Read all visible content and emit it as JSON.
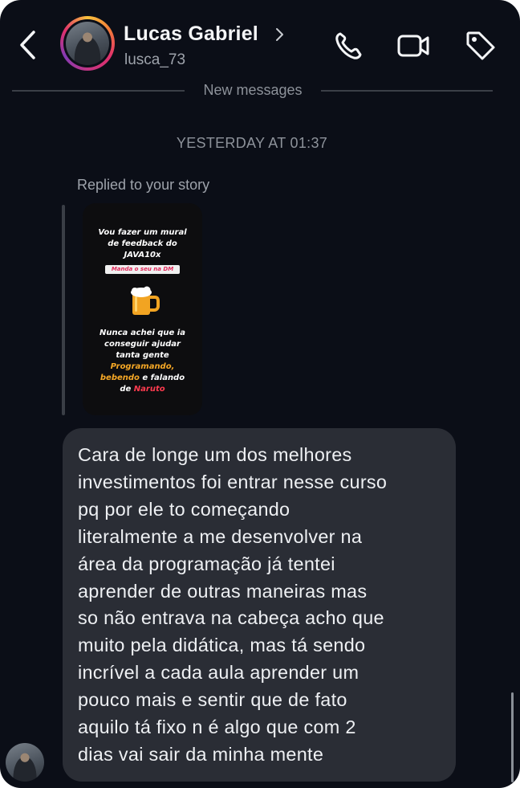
{
  "header": {
    "contact_name": "Lucas Gabriel",
    "contact_handle": "lusca_73",
    "icons": [
      "back-arrow-icon",
      "chevron-right-icon",
      "phone-icon",
      "video-camera-icon",
      "tag-icon"
    ]
  },
  "divider": {
    "label": "New messages"
  },
  "thread": {
    "timestamp": "YESTERDAY AT 01:37",
    "reply_label": "Replied to your story",
    "story": {
      "line1": "Vou fazer um mural",
      "line2": "de feedback do",
      "line3": "JAVA10x",
      "badge": "Manda o seu na DM",
      "emoji": "beer-mug-icon",
      "line4": "Nunca achei que ia",
      "line5": "conseguir ajudar",
      "line6": "tanta gente",
      "line7": "Programando,",
      "line8a": "bebendo",
      "line8b": " e falando",
      "line9a": "de ",
      "line9b": "Naruto"
    },
    "message": {
      "lines": [
        "Cara de longe um dos melhores",
        "investimentos foi entrar nesse curso",
        "pq por ele to começando",
        "literalmente a me desenvolver na",
        "área da programação já tentei",
        "aprender de outras maneiras mas",
        "so não entrava na cabeça acho que",
        "muito pela didática, mas tá sendo",
        "incrível a cada aula aprender um",
        "pouco mais e sentir que de fato",
        "aquilo tá fixo n é algo que com 2",
        "dias vai sair da minha mente"
      ]
    }
  },
  "colors": {
    "background": "#0b0e17",
    "bubble": "#2a2d35",
    "text_primary": "#f4f5f7",
    "text_secondary": "#9ea3ab",
    "story_orange": "#f6a826",
    "story_red": "#ff3b4f"
  }
}
